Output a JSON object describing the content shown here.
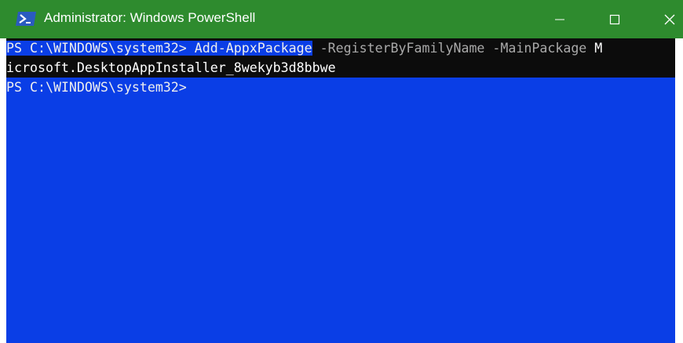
{
  "window": {
    "title": "Administrator: Windows PowerShell",
    "icon": "powershell-icon",
    "controls": [
      "minimize-icon",
      "maximize-icon",
      "close-icon"
    ]
  },
  "colors": {
    "titlebar": "#2e8b2e",
    "console_background": "#0a3ee6",
    "console_text": "#eeeeee",
    "parameter_text": "#a9a9a9"
  },
  "console": {
    "line1_prompt": "PS C:\\WINDOWS\\system32> ",
    "line1_command": "Add-AppxPackage",
    "line1_params": " -RegisterByFamilyName -MainPackage ",
    "line1_wrap": "M",
    "line2_text": "icrosoft.DesktopAppInstaller_8wekyb3d8bbwe",
    "line3_prompt": "PS C:\\WINDOWS\\system32>"
  }
}
